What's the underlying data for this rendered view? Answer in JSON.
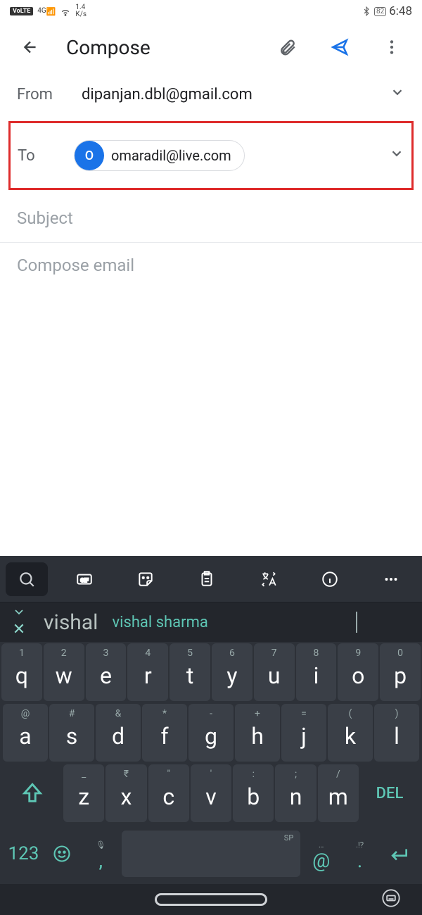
{
  "status": {
    "volte": "VoLTE",
    "net": "4G",
    "speed_top": "1.4",
    "speed_bot": "K/s",
    "battery": "82",
    "time": "6:48"
  },
  "appbar": {
    "title": "Compose"
  },
  "from": {
    "label": "From",
    "value": "dipanjan.dbl@gmail.com"
  },
  "to": {
    "label": "To",
    "chip_initial": "O",
    "chip_email": "omaradil@live.com"
  },
  "subject": {
    "placeholder": "Subject"
  },
  "body": {
    "placeholder": "Compose email"
  },
  "keyboard": {
    "suggestions": {
      "s1": "vishal",
      "s2": "vishal sharma"
    },
    "row1": [
      {
        "n": "1",
        "l": "q"
      },
      {
        "n": "2",
        "l": "w"
      },
      {
        "n": "3",
        "l": "e"
      },
      {
        "n": "4",
        "l": "r"
      },
      {
        "n": "5",
        "l": "t"
      },
      {
        "n": "6",
        "l": "y"
      },
      {
        "n": "7",
        "l": "u"
      },
      {
        "n": "8",
        "l": "i"
      },
      {
        "n": "9",
        "l": "o"
      },
      {
        "n": "0",
        "l": "p"
      }
    ],
    "row2": [
      {
        "s": "@",
        "l": "a"
      },
      {
        "s": "#",
        "l": "s"
      },
      {
        "s": "&",
        "l": "d"
      },
      {
        "s": "*",
        "l": "f"
      },
      {
        "s": "-",
        "l": "g"
      },
      {
        "s": "+",
        "l": "h"
      },
      {
        "s": "=",
        "l": "j"
      },
      {
        "s": "(",
        "l": "k"
      },
      {
        "s": ")",
        "l": "l"
      }
    ],
    "row3": [
      {
        "s": "_",
        "l": "z"
      },
      {
        "s": "₹",
        "l": "x"
      },
      {
        "s": "\"",
        "l": "c"
      },
      {
        "s": "'",
        "l": "v"
      },
      {
        "s": ":",
        "l": "b"
      },
      {
        "s": ";",
        "l": "n"
      },
      {
        "s": "/",
        "l": "m"
      }
    ],
    "del": "DEL",
    "numkey": "123",
    "comma_top": "🎤",
    "comma": ",",
    "at_top": "…",
    "at": "@",
    "dot_top": ".!?",
    "dot": ".",
    "space_lbl": "SP"
  }
}
